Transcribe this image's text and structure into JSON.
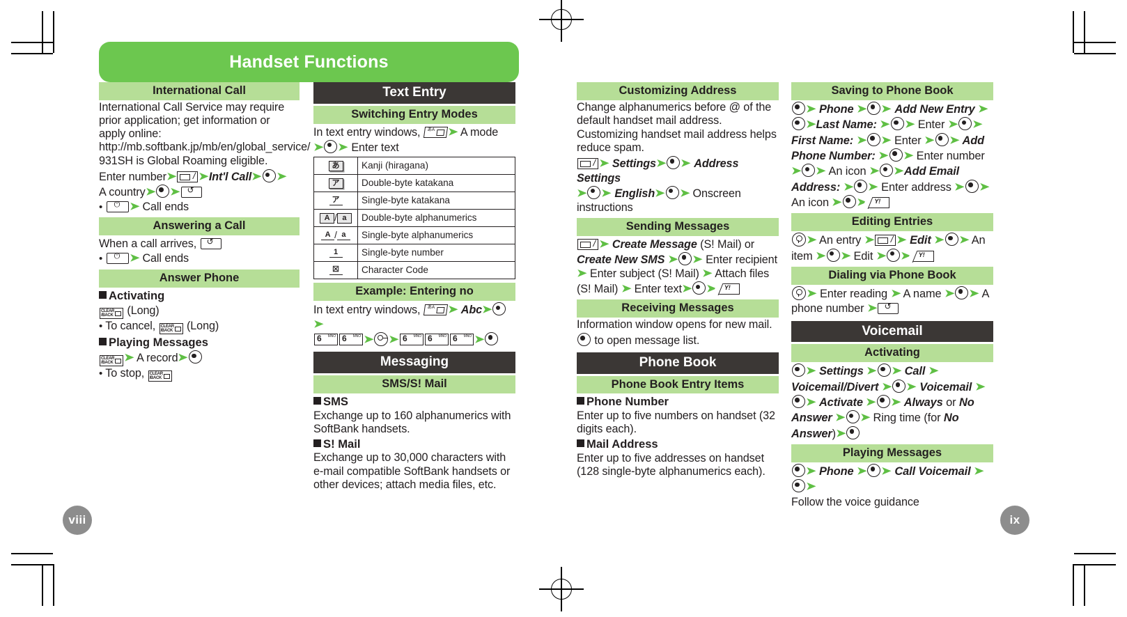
{
  "document": {
    "title": "Handset Functions",
    "page_left": "viii",
    "page_right": "ix",
    "colors": {
      "title_green": "#6cc74f",
      "section_green": "#b6de97",
      "bar_dark": "#3b3735",
      "page_number_gray": "#8d8d8d",
      "arrow_green": "#5fbf44"
    }
  },
  "col1": {
    "international_call": {
      "heading": "International Call",
      "p1": "International Call Service may require prior application; get information or apply online: http://mb.softbank.jp/mb/en/global_service/",
      "p2": "931SH is Global Roaming eligible.",
      "step_enter_number": "Enter number",
      "step_intl_call": "Int'l Call",
      "step_country": "A country",
      "bullet_call_ends": "Call ends"
    },
    "answering_a_call": {
      "heading": "Answering a Call",
      "p1": "When a call arrives,",
      "bullet_call_ends": "Call ends"
    },
    "answer_phone": {
      "heading": "Answer Phone",
      "sub_activating": "Activating",
      "activating_long": "(Long)",
      "activating_cancel_prefix": "To cancel,",
      "activating_cancel_long": "(Long)",
      "sub_playing": "Playing Messages",
      "playing_a_record": "A record",
      "to_stop": "To stop,"
    }
  },
  "col2": {
    "text_entry": {
      "heading": "Text Entry",
      "switching": {
        "heading": "Switching Entry Modes",
        "line1_pre": "In text entry windows,",
        "line1_post": "A mode",
        "line2": "Enter text",
        "table_rows": [
          {
            "icon": "kanji-hiragana-icon",
            "glyph": "あ",
            "label": "Kanji (hiragana)"
          },
          {
            "icon": "double-byte-katakana-icon",
            "glyph": "ア",
            "label": "Double-byte katakana"
          },
          {
            "icon": "single-byte-katakana-icon",
            "glyph": "ア",
            "label": "Single-byte katakana"
          },
          {
            "icon": "double-byte-alpha-icon",
            "glyph": "A / a",
            "label": "Double-byte alphanumerics"
          },
          {
            "icon": "single-byte-alpha-icon",
            "glyph": "A / a",
            "label": "Single-byte alphanumerics"
          },
          {
            "icon": "single-byte-number-icon",
            "glyph": "1",
            "label": "Single-byte number"
          },
          {
            "icon": "character-code-icon",
            "glyph": "☒",
            "label": "Character Code"
          }
        ]
      },
      "example": {
        "heading": "Example: Entering no",
        "line1_pre": "In text entry windows,",
        "line1_abc": "Abc",
        "key_digit": "6",
        "key_sub": "MNO"
      }
    },
    "messaging": {
      "heading": "Messaging",
      "sms_smail": {
        "heading": "SMS/S! Mail",
        "sub_sms": "SMS",
        "sms_text": "Exchange up to 160 alphanumerics with SoftBank handsets.",
        "sub_smail": "S! Mail",
        "smail_text": "Exchange up to 30,000 characters with e-mail compatible SoftBank handsets or other devices; attach media files, etc."
      }
    }
  },
  "col3": {
    "customizing_address": {
      "heading": "Customizing Address",
      "p1": "Change alphanumerics before @ of the default handset mail address.",
      "p2": "Customizing handset mail address helps reduce spam.",
      "s_settings": "Settings",
      "s_address_settings": "Address Settings",
      "s_english": "English",
      "s_onscreen": "Onscreen instructions"
    },
    "sending_messages": {
      "heading": "Sending Messages",
      "s_create_message": "Create Message",
      "s_smail_paren": "(S! Mail) or",
      "s_create_new_sms": "Create New SMS",
      "s_enter_recipient": "Enter recipient",
      "s_enter_subject": "Enter subject (S! Mail)",
      "s_attach_files": "Attach files (S! Mail)",
      "s_enter_text": "Enter text"
    },
    "receiving_messages": {
      "heading": "Receiving Messages",
      "p1": "Information window opens for new mail.",
      "p2": "to open message list."
    },
    "phone_book": {
      "heading": "Phone Book",
      "entry_items": {
        "heading": "Phone Book Entry Items",
        "sub_phone_number": "Phone Number",
        "phone_number_text": "Enter up to five numbers on handset (32 digits each).",
        "sub_mail_address": "Mail Address",
        "mail_address_text": "Enter up to five addresses on handset (128 single-byte alphanumerics each)."
      }
    }
  },
  "col4": {
    "saving_to_phone_book": {
      "heading": "Saving to Phone Book",
      "s_phone": "Phone",
      "s_add_new_entry": "Add New Entry",
      "s_last_name": "Last Name:",
      "s_enter": "Enter",
      "s_first_name": "First Name:",
      "s_enter2": "Enter",
      "s_add_phone_number": "Add Phone Number:",
      "s_enter_number": "Enter number",
      "s_an_icon": "An icon",
      "s_add_email_address": "Add Email Address:",
      "s_enter_address": "Enter address",
      "s_an_icon2": "An icon"
    },
    "editing_entries": {
      "heading": "Editing Entries",
      "s_an_entry": "An entry",
      "s_edit": "Edit",
      "s_an_item": "An item",
      "s_edit2": "Edit"
    },
    "dialing_via_phone_book": {
      "heading": "Dialing via Phone Book",
      "s_enter_reading": "Enter reading",
      "s_a_name": "A name",
      "s_a_phone_number": "A phone number"
    },
    "voicemail": {
      "heading": "Voicemail",
      "activating": {
        "heading": "Activating",
        "s_settings": "Settings",
        "s_call": "Call",
        "s_voicemail_divert": "Voicemail/Divert",
        "s_voicemail": "Voicemail",
        "s_activate": "Activate",
        "s_always": "Always",
        "s_or": "or",
        "s_no_answer": "No Answer",
        "s_ring_time": "Ring time (for",
        "s_no_answer2": "No Answer",
        "s_close": ")"
      },
      "playing_messages": {
        "heading": "Playing Messages",
        "s_phone": "Phone",
        "s_call_voicemail": "Call Voicemail",
        "p_follow": "Follow the voice guidance"
      }
    }
  }
}
